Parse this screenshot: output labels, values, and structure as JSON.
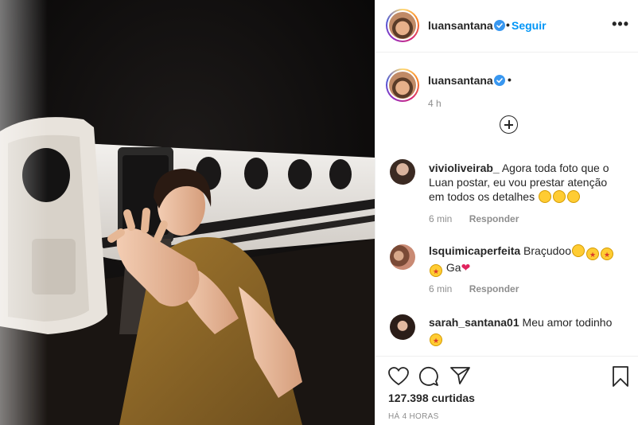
{
  "header": {
    "username": "luansantana",
    "follow_label": "Seguir",
    "more_label": "•••"
  },
  "caption": {
    "username": "luansantana",
    "dot": "•",
    "time": "4 h"
  },
  "comments": [
    {
      "username": "vivioliveirab_",
      "text": "Agora toda foto que o Luan postar, eu vou prestar atenção em todos os detalhes",
      "time": "6 min",
      "reply_label": "Responder"
    },
    {
      "username": "lsquimicaperfeita",
      "text": "Braçudoo",
      "text2": "Ga",
      "time": "6 min",
      "reply_label": "Responder"
    },
    {
      "username": "sarah_santana01",
      "text": "Meu amor todinho"
    }
  ],
  "footer": {
    "likes": "127.398 curtidas",
    "posted": "HÁ 4 HORAS"
  },
  "icons": [
    "verified-badge-icon",
    "add-comment-icon",
    "heart-icon",
    "comment-icon",
    "share-icon",
    "bookmark-icon",
    "more-options-icon"
  ],
  "colors": {
    "accent": "#0095f6",
    "text": "#262626",
    "muted": "#8e8e8e",
    "reply_heart": "#e0245e"
  }
}
